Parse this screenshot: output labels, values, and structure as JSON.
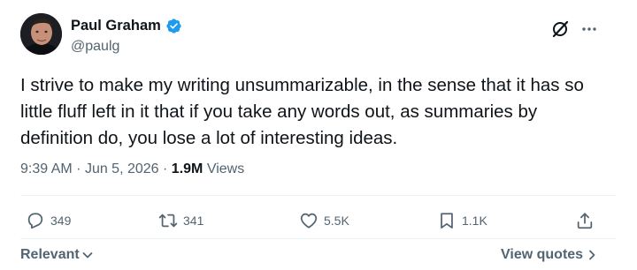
{
  "author": {
    "display_name": "Paul Graham",
    "handle": "@paulg",
    "verified": true
  },
  "tweet": {
    "text": "I strive to make my writing unsummarizable, in the sense that it has so\nlittle fluff left in it that if you take any words out, as summaries by\ndefinition do, you lose a lot of interesting ideas.",
    "time": "9:39 AM",
    "date": "Jun 5, 2026",
    "views_count": "1.9M",
    "views_label": "Views"
  },
  "actions": {
    "reply": {
      "icon": "reply-icon",
      "count": "349"
    },
    "retweet": {
      "icon": "retweet-icon",
      "count": "341"
    },
    "like": {
      "icon": "heart-icon",
      "count": "5.5K"
    },
    "bookmark": {
      "icon": "bookmark-icon",
      "count": "1.1K"
    },
    "share": {
      "icon": "share-icon"
    }
  },
  "footer": {
    "sort_label": "Relevant",
    "view_quotes_label": "View quotes"
  },
  "colors": {
    "text_primary": "#0f1419",
    "text_secondary": "#536471",
    "verified_blue": "#1d9bf0",
    "divider": "#eff3f4"
  }
}
